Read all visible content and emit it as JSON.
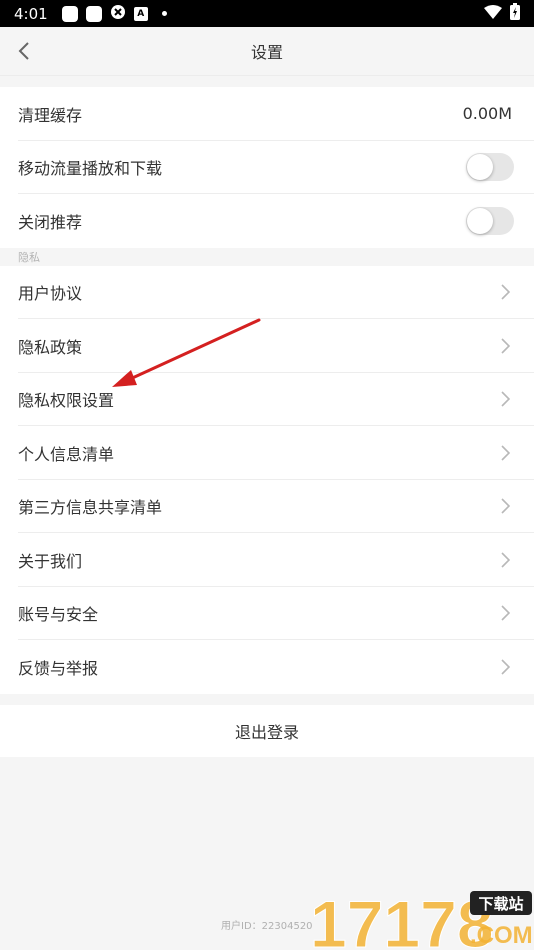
{
  "status_bar": {
    "time": "4:01",
    "icons": [
      "square-icon",
      "square-icon",
      "sync-icon",
      "a-icon",
      "dot-icon",
      "wifi-icon",
      "battery-icon"
    ]
  },
  "nav": {
    "title": "设置",
    "back_icon": "chevron-left-icon"
  },
  "general": {
    "items": [
      {
        "label": "清理缓存",
        "value": "0.00M"
      },
      {
        "label": "移动流量播放和下载",
        "toggle": false
      },
      {
        "label": "关闭推荐",
        "toggle": false
      }
    ]
  },
  "privacy": {
    "header": "隐私",
    "items": [
      {
        "label": "用户协议"
      },
      {
        "label": "隐私政策"
      },
      {
        "label": "隐私权限设置"
      },
      {
        "label": "个人信息清单"
      },
      {
        "label": "第三方信息共享清单"
      },
      {
        "label": "关于我们"
      },
      {
        "label": "账号与安全"
      },
      {
        "label": "反馈与举报"
      }
    ]
  },
  "logout": {
    "label": "退出登录"
  },
  "footer": {
    "user_id": "用户ID：22304520"
  },
  "watermark": {
    "text": "17178",
    "sub": "下载站",
    "domain": ".COM"
  },
  "colors": {
    "arrow": "#d42020",
    "watermark_orange": "#f2b233"
  }
}
